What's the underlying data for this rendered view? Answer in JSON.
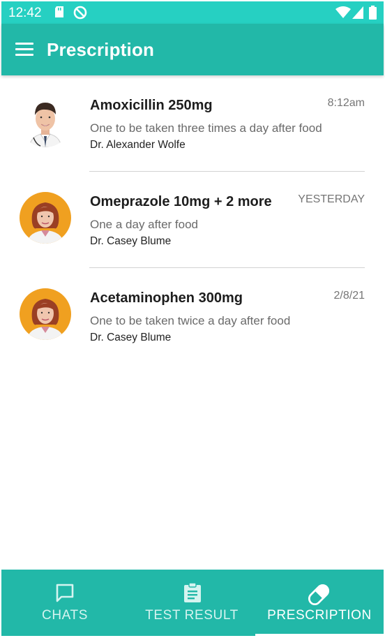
{
  "status_bar": {
    "time": "12:42",
    "icons": [
      "sd-card-icon",
      "do-not-disturb-icon",
      "wifi-icon",
      "cell-signal-icon",
      "battery-icon"
    ]
  },
  "app_bar": {
    "title": "Prescription",
    "menu_icon": "hamburger-menu-icon"
  },
  "prescriptions": [
    {
      "name": "Amoxicillin 250mg",
      "time": "8:12am",
      "instructions": "One to be taken three times a day after food",
      "doctor": "Dr. Alexander Wolfe",
      "avatar": "male-doctor-photo"
    },
    {
      "name": "Omeprazole 10mg + 2 more",
      "time": "YESTERDAY",
      "instructions": "One a day after food",
      "doctor": "Dr. Casey Blume",
      "avatar": "female-doctor-photo"
    },
    {
      "name": "Acetaminophen 300mg",
      "time": "2/8/21",
      "instructions": "One to be taken twice a day after food",
      "doctor": "Dr. Casey Blume",
      "avatar": "female-doctor-photo"
    }
  ],
  "bottom_nav": {
    "tabs": [
      {
        "label": "CHATS",
        "icon": "chat-bubble-icon",
        "active": false
      },
      {
        "label": "TEST RESULT",
        "icon": "clipboard-icon",
        "active": false
      },
      {
        "label": "PRESCRIPTION",
        "icon": "pill-icon",
        "active": true
      }
    ]
  },
  "colors": {
    "status_bar": "#26d0c2",
    "primary": "#22b8a8",
    "avatar_female_bg": "#f0a020"
  }
}
